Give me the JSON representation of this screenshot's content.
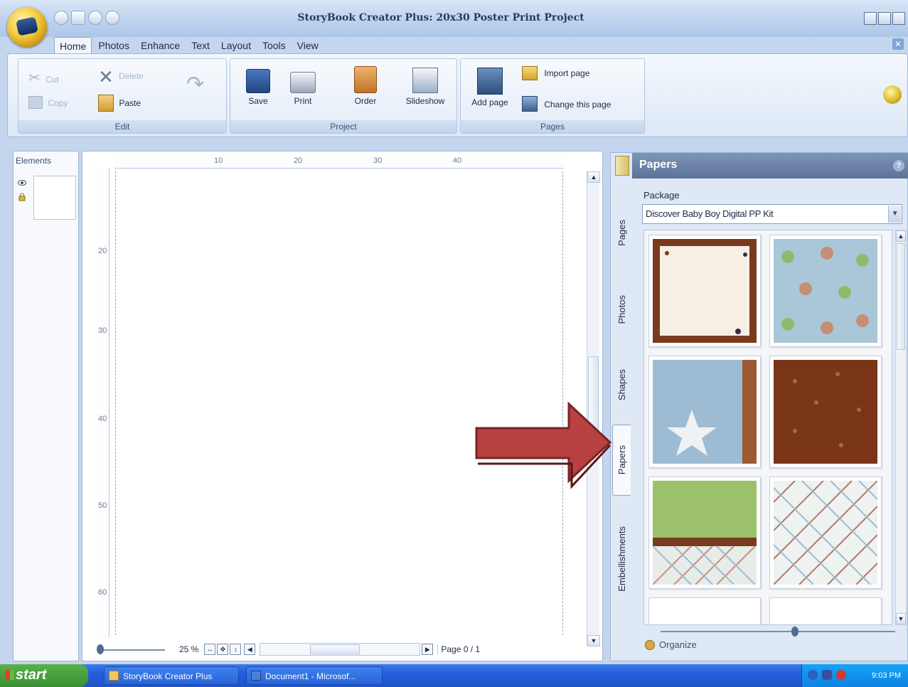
{
  "window": {
    "title": "StoryBook Creator Plus: 20x30 Poster Print Project"
  },
  "menu": {
    "tabs": [
      "Home",
      "Photos",
      "Enhance",
      "Text",
      "Layout",
      "Tools",
      "View"
    ],
    "active_tab": "Home"
  },
  "ribbon": {
    "edit": {
      "label": "Edit",
      "cut": "Cut",
      "delete": "Delete",
      "copy": "Copy",
      "paste": "Paste"
    },
    "project": {
      "label": "Project",
      "save": "Save",
      "print": "Print",
      "order": "Order",
      "slideshow": "Slideshow"
    },
    "pages": {
      "label": "Pages",
      "add_page": "Add page",
      "import_page": "Import page",
      "change_page": "Change this page"
    }
  },
  "elements_panel": {
    "title": "Elements"
  },
  "canvas": {
    "ruler_h": [
      "10",
      "20",
      "30",
      "40"
    ],
    "ruler_v": [
      "20",
      "30",
      "40",
      "50",
      "60"
    ],
    "zoom": "25 %",
    "page_indicator": "Page 0 / 1"
  },
  "right_panel": {
    "title": "Papers",
    "package_label": "Package",
    "package_value": "Discover Baby Boy Digital PP Kit",
    "vertical_tabs": [
      "Pages",
      "Photos",
      "Shapes",
      "Papers",
      "Embellishments"
    ],
    "active_tab": "Papers",
    "organize": "Organize"
  },
  "taskbar": {
    "start": "start",
    "items": [
      "StoryBook Creator Plus",
      "Document1 - Microsof..."
    ],
    "clock": "9:03 PM"
  },
  "colors": {
    "accent_arrow": "#b84141",
    "panel_header": "#5b7398",
    "taskbar": "#245edb"
  }
}
